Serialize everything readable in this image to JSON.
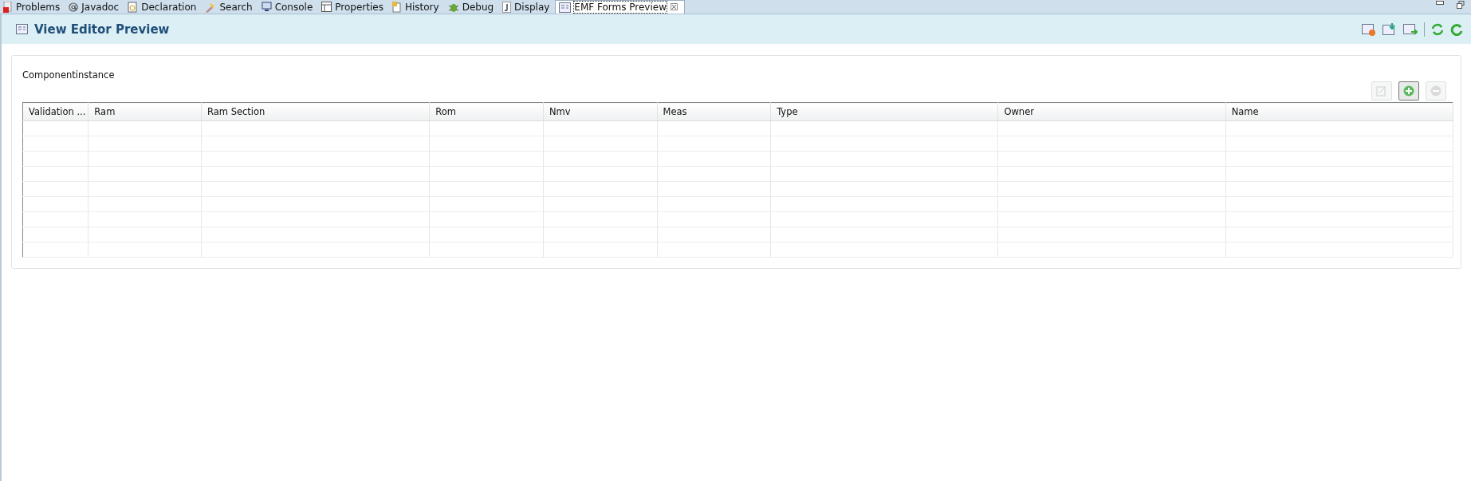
{
  "tabs": [
    {
      "label": "Problems",
      "kind": "problems",
      "selected": false
    },
    {
      "label": "Javadoc",
      "kind": "at",
      "selected": false
    },
    {
      "label": "Declaration",
      "kind": "doc",
      "selected": false
    },
    {
      "label": "Search",
      "kind": "torch",
      "selected": false
    },
    {
      "label": "Console",
      "kind": "monitor",
      "selected": false
    },
    {
      "label": "Properties",
      "kind": "table",
      "selected": false
    },
    {
      "label": "History",
      "kind": "history",
      "selected": false
    },
    {
      "label": "Debug",
      "kind": "bug",
      "selected": false
    },
    {
      "label": "Display",
      "kind": "j",
      "selected": false
    },
    {
      "label": "EMF Forms Preview",
      "kind": "form",
      "selected": true,
      "close": "☒"
    }
  ],
  "view": {
    "title": "View Editor Preview"
  },
  "section": {
    "title": "Componentinstance",
    "buttons": [
      {
        "kind": "edit",
        "disabled": true
      },
      {
        "kind": "add",
        "disabled": false
      },
      {
        "kind": "remove",
        "disabled": true
      }
    ]
  },
  "table": {
    "columns": [
      "Validation ...",
      "Ram",
      "Ram Section",
      "Rom",
      "Nmv",
      "Meas",
      "Type",
      "Owner",
      "Name"
    ]
  }
}
